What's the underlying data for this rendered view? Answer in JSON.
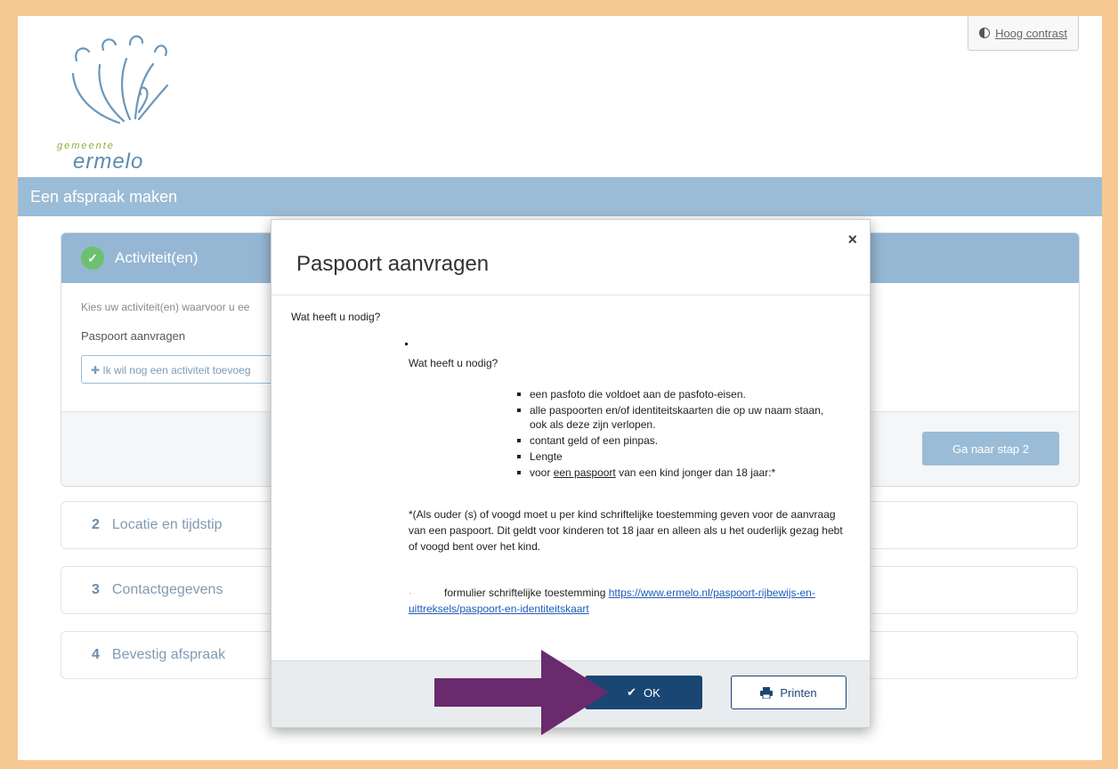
{
  "header": {
    "logo_gemeente": "gemeente",
    "logo_ermelo": "ermelo",
    "contrast_label": "Hoog contrast"
  },
  "titlebar": "Een afspraak maken",
  "step1": {
    "title": "Activiteit(en)",
    "hint": "Kies uw activiteit(en) waarvoor u ee",
    "activity": "Paspoort aanvragen",
    "add_label": "Ik wil nog een activiteit toevoeg",
    "next_label": "Ga naar stap 2"
  },
  "steps": [
    {
      "num": "2",
      "label": "Locatie en tijdstip"
    },
    {
      "num": "3",
      "label": "Contactgegevens"
    },
    {
      "num": "4",
      "label": "Bevestig afspraak"
    }
  ],
  "modal": {
    "title": "Paspoort aanvragen",
    "close": "×",
    "question": "Wat heeft u nodig?",
    "inner_question": "Wat heeft u nodig?",
    "items": [
      "een pasfoto die voldoet aan de pasfoto-eisen.",
      "alle paspoorten en/of identiteitskaarten die op uw naam staan, ook als deze zijn verlopen.",
      "contant geld of een pinpas.",
      "Lengte"
    ],
    "item5_pre": "voor ",
    "item5_link": "een paspoort",
    "item5_post": " van een kind jonger dan 18 jaar:*",
    "note": "*(Als ouder (s) of voogd  moet u  per kind schriftelijke toestemming geven voor de aanvraag van een paspoort. Dit geldt voor kinderen tot 18 jaar en alleen als u het ouderlijk gezag hebt of voogd bent over het kind.",
    "form_dot": "·",
    "form_text": "formulier schriftelijke toestemming ",
    "form_link": "https://www.ermelo.nl/paspoort-rijbewijs-en-uittreksels/paspoort-en-identiteitskaart",
    "ok_label": "OK",
    "print_label": "Printen"
  },
  "colors": {
    "accent": "#9bbcd6",
    "ok_button": "#1a4673",
    "arrow": "#6a2a6e",
    "frame": "#f6c993"
  }
}
